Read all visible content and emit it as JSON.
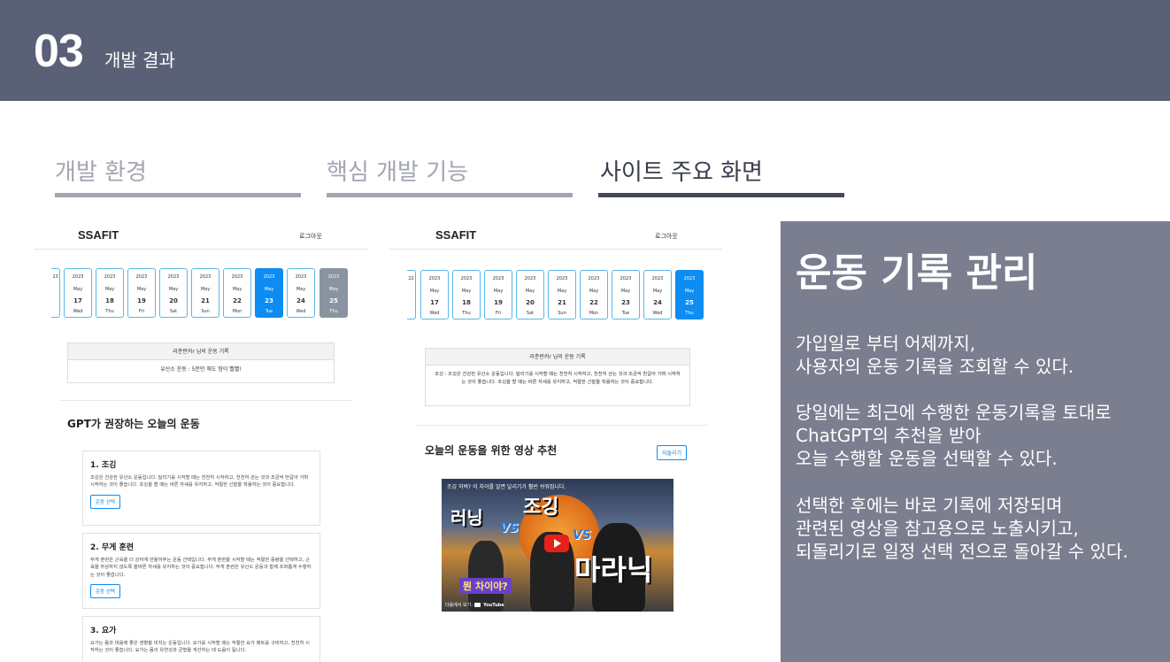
{
  "header": {
    "number": "03",
    "subtitle": "개발 결과"
  },
  "tabs": [
    {
      "label": "개발 환경",
      "active": false
    },
    {
      "label": "핵심 개발 기능",
      "active": false
    },
    {
      "label": "사이트 주요 화면",
      "active": true
    }
  ],
  "shot_left": {
    "brand": "SSAFIT",
    "logout": "로그아웃",
    "dates": [
      {
        "y": "2023",
        "m": "May",
        "d": "17",
        "w": "Wed"
      },
      {
        "y": "2023",
        "m": "May",
        "d": "18",
        "w": "Thu"
      },
      {
        "y": "2023",
        "m": "May",
        "d": "19",
        "w": "Fri"
      },
      {
        "y": "2023",
        "m": "May",
        "d": "20",
        "w": "Sat"
      },
      {
        "y": "2023",
        "m": "May",
        "d": "21",
        "w": "Sun"
      },
      {
        "y": "2023",
        "m": "May",
        "d": "22",
        "w": "Mon"
      },
      {
        "y": "2023",
        "m": "May",
        "d": "23",
        "w": "Tue"
      },
      {
        "y": "2023",
        "m": "May",
        "d": "24",
        "w": "Wed"
      },
      {
        "y": "2023",
        "m": "May",
        "d": "25",
        "w": "Thu"
      }
    ],
    "record_head": "리춘란커r 님의 운동 기록",
    "record_body": "유산소 운동 : 5분만 해도 땀이 뻘뻘!",
    "gpt_title": "GPT가 권장하는 오늘의 운동",
    "cards": [
      {
        "title": "1. 조깅",
        "desc": "조깅은 건강한 유산소 운동입니다. 달리기를 시작할 때는 천천히 시작하고, 천천히 걷는 것과 조금씩 번갈아 가며 시작하는 것이 좋습니다. 조깅을 할 때는 바른 자세를 유지하고, 적절한 신발을 착용하는 것이 중요합니다.",
        "btn": "운동 선택"
      },
      {
        "title": "2. 무게 훈련",
        "desc": "무게 훈련은 근육을 더 강하게 만들어주는 운동 선택입니다. 무게 훈련을 시작할 때는 적절한 중량을 선택하고, 근육을 부상하지 않도록 올바른 자세를 유지하는 것이 중요합니다. 무게 훈련은 유산소 운동과 함께 조화롭게 수행하는 것이 좋습니다.",
        "btn": "운동 선택"
      },
      {
        "title": "3. 요가",
        "desc": "요가는 몸과 마음에 좋은 영향을 미치는 운동입니다. 요가를 시작할 때는 적절한 요가 매트를 구비하고, 천천히 시작하는 것이 좋습니다. 요가는 몸의 유연성과 균형을 개선하는 데 도움이 됩니다.",
        "btn": ""
      }
    ]
  },
  "shot_right": {
    "brand": "SSAFIT",
    "logout": "로그아웃",
    "record_head": "리춘란커r 님의 운동 기록",
    "record_body": "조깅 : 조깅은 건강한 유산소 운동입니다. 달리기를 시작할 때는 천천히 시작하고, 천천히 걷는 것과 조금씩 번갈아 가며 시작하는 것이 좋습니다. 조깅을 할 때는 바른 자세를 유지하고, 적절한 신발을 착용하는 것이 중요합니다.",
    "video_section_title": "오늘의 운동을 위한 영상 추천",
    "back_button": "되돌리기",
    "video": {
      "title": "조깅 허벅? 이 차이를 알면 달리기가 훨씬 쉬워집니다.",
      "big_left": "러닝",
      "big_top": "조깅",
      "big_right": "마라닉",
      "vs": "VS",
      "question": "뭔 차이야?",
      "watch_on": "다음에서 보기:",
      "youtube": "YouTube"
    }
  },
  "info": {
    "title": "운동 기록 관리",
    "paragraphs": [
      [
        "가입일로 부터 어제까지,",
        "사용자의 운동 기록을 조회할 수 있다."
      ],
      [
        "당일에는 최근에 수행한 운동기록을 토대로",
        "ChatGPT의 추천을 받아",
        "오늘 수행할 운동을 선택할 수 있다."
      ],
      [
        "선택한 후에는 바로 기록에 저장되며",
        "관련된 영상을 참고용으로 노출시키고,",
        "되돌리기로 일정 선택 전으로 돌아갈 수 있다."
      ]
    ]
  },
  "colors": {
    "header_bg": "#5a6075",
    "info_bg": "#7a7e8f",
    "accent_blue": "#0d8cf2",
    "tab_inactive": "#a3a6b2",
    "tab_active": "#434859"
  }
}
